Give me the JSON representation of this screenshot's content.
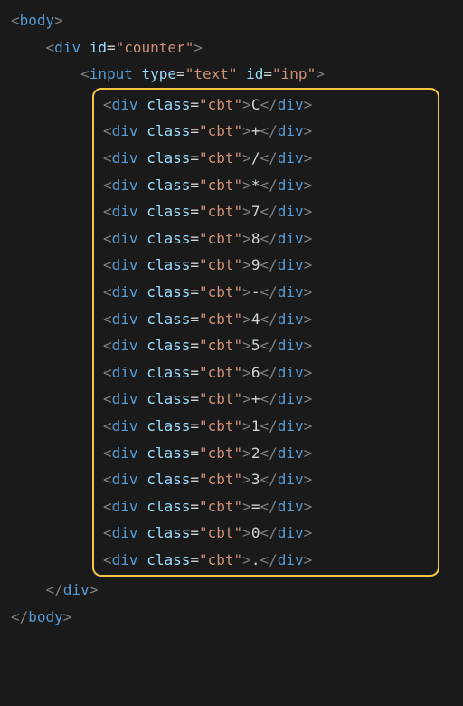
{
  "lines": {
    "body_open": {
      "tag": "body"
    },
    "counter_open": {
      "tag": "div",
      "attr": "id",
      "value": "\"counter\""
    },
    "input_line": {
      "tag": "input",
      "attr1": "type",
      "value1": "\"text\"",
      "attr2": "id",
      "value2": "\"inp\""
    },
    "div_close": "div",
    "body_close": "body"
  },
  "cbt_items": [
    {
      "text": "C"
    },
    {
      "text": "+"
    },
    {
      "text": "/"
    },
    {
      "text": "*"
    },
    {
      "text": "7"
    },
    {
      "text": "8"
    },
    {
      "text": "9"
    },
    {
      "text": "-"
    },
    {
      "text": "4"
    },
    {
      "text": "5"
    },
    {
      "text": "6"
    },
    {
      "text": "+"
    },
    {
      "text": "1"
    },
    {
      "text": "2"
    },
    {
      "text": "3"
    },
    {
      "text": "="
    },
    {
      "text": "0"
    },
    {
      "text": "."
    }
  ],
  "cbt_tag": "div",
  "cbt_attr": "class",
  "cbt_value": "\"cbt\""
}
